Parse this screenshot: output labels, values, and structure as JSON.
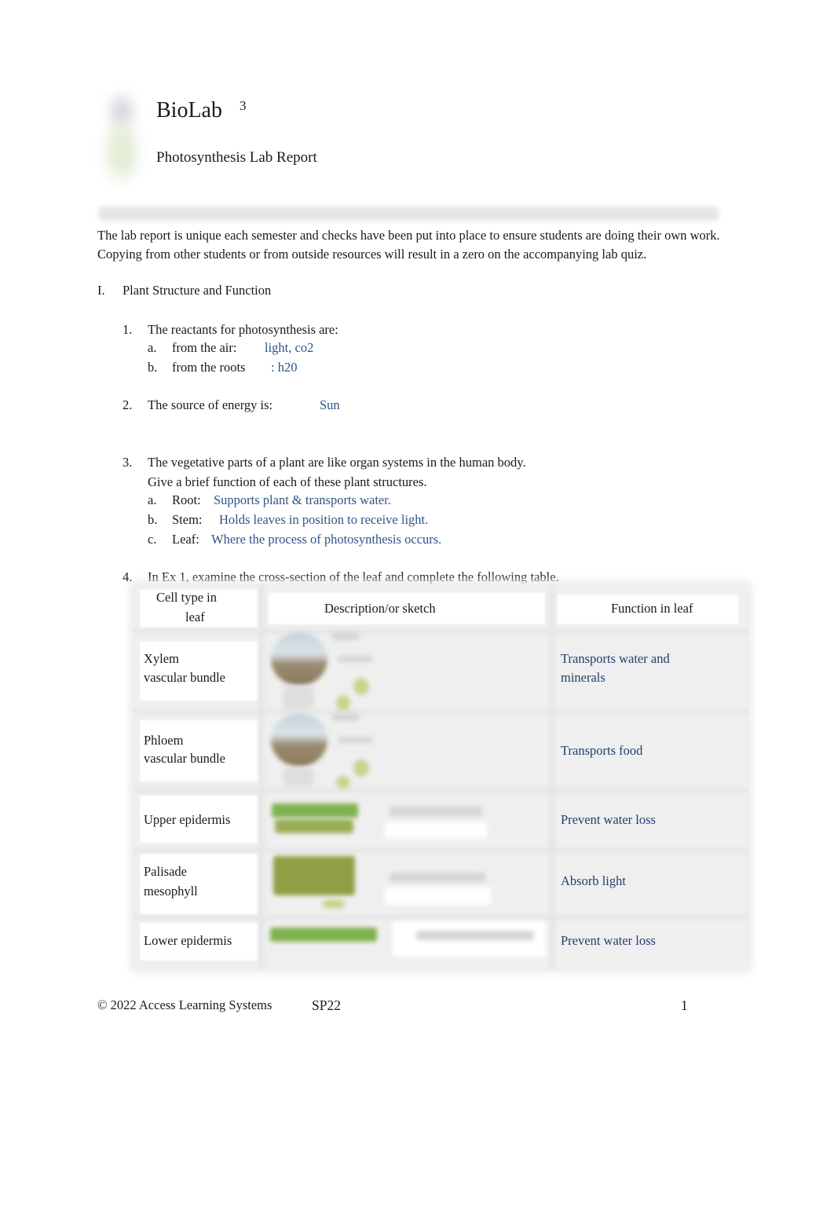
{
  "header": {
    "title": "BioLab",
    "title_superscript": "3",
    "subtitle": "Photosynthesis Lab Report",
    "logo_icon": "plant-logo-icon"
  },
  "intro": "The lab report is unique each semester and checks have been put into place to ensure students are doing their own work. Copying from other students or from outside resources will result in a zero on the accompanying lab quiz.",
  "section": {
    "numeral": "I.",
    "title": "Plant Structure and Function"
  },
  "questions": {
    "q1": {
      "num": "1.",
      "text": "The reactants for photosynthesis are:",
      "a": {
        "letter": "a.",
        "label": "from the air:",
        "answer": "light, co2"
      },
      "b": {
        "letter": "b.",
        "label": "from the roots",
        "answer": ": h20"
      }
    },
    "q2": {
      "num": "2.",
      "text": "The source of energy is:",
      "answer": "Sun"
    },
    "q3": {
      "num": "3.",
      "text_line1": "The vegetative parts of a plant are like organ systems in the human body.",
      "text_line2": "Give a brief function of each of these plant structures.",
      "a": {
        "letter": "a.",
        "label": "Root:",
        "answer": "Supports plant & transports water."
      },
      "b": {
        "letter": "b.",
        "label": "Stem:",
        "answer": "Holds leaves in position to receive light."
      },
      "c": {
        "letter": "c.",
        "label": "Leaf:",
        "answer": "Where the process of photosynthesis occurs."
      }
    },
    "q4": {
      "num": "4.",
      "text": "In Ex 1, examine the cross-section of the leaf and complete the following table."
    }
  },
  "table": {
    "headers": {
      "cell_type_line1": "Cell type in",
      "cell_type_line2": "leaf",
      "description": "Description/or sketch",
      "function": "Function in leaf"
    },
    "rows": [
      {
        "cell_line1": "Xylem",
        "cell_line2": "vascular bundle",
        "function_line1": "Transports water and",
        "function_line2": "minerals",
        "sketch": "vascular-bundle-sketch"
      },
      {
        "cell_line1": "Phloem",
        "cell_line2": "vascular bundle",
        "function_line1": "Transports food",
        "function_line2": "",
        "sketch": "vascular-bundle-sketch"
      },
      {
        "cell_line1": "Upper epidermis",
        "cell_line2": "",
        "function_line1": "Prevent water loss",
        "function_line2": "",
        "sketch": "upper-epidermis-sketch"
      },
      {
        "cell_line1": "Palisade",
        "cell_line2": "mesophyll",
        "function_line1": "Absorb light",
        "function_line2": "",
        "sketch": "palisade-mesophyll-sketch"
      },
      {
        "cell_line1": "Lower epidermis",
        "cell_line2": "",
        "function_line1": "Prevent water loss",
        "function_line2": "",
        "sketch": "lower-epidermis-sketch"
      }
    ]
  },
  "footer": {
    "copyright": "© 2022 Access Learning Systems",
    "term": "SP22",
    "page_number": "1"
  },
  "colors": {
    "answer_blue": "#2e5487",
    "table_answer_blue": "#1f3f6e"
  }
}
